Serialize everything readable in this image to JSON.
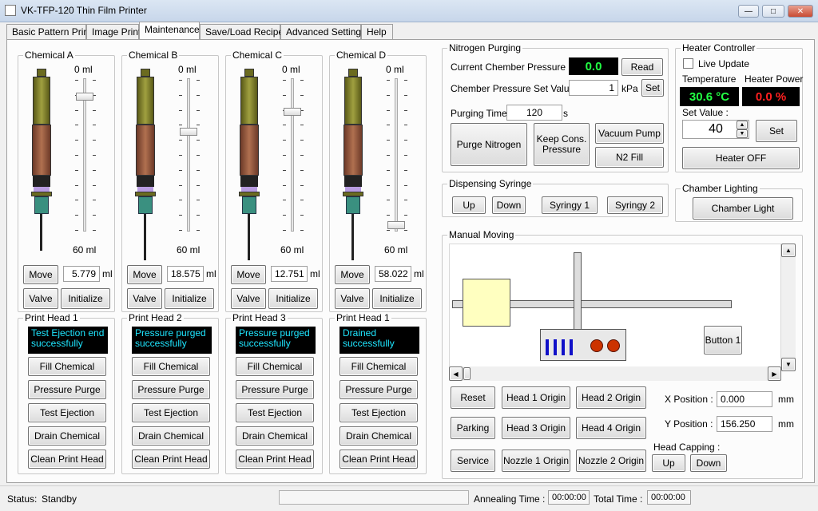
{
  "window": {
    "title": "VK-TFP-120 Thin Film Printer"
  },
  "tabs": [
    "Basic Pattern Print",
    "Image Print",
    "Maintenance",
    "Save/Load Recipe",
    "Advanced Settings",
    "Help"
  ],
  "chemicals": [
    {
      "title": "Chemical A",
      "top_label": "0 ml",
      "bottom_label": "60 ml",
      "volume": "5.779",
      "unit": "ml",
      "move": "Move",
      "valve": "Valve",
      "initialize": "Initialize",
      "level": 0.12,
      "head_title": "Print Head 1",
      "message": "Test Ejection end successfully"
    },
    {
      "title": "Chemical B",
      "top_label": "0 ml",
      "bottom_label": "60 ml",
      "volume": "18.575",
      "unit": "ml",
      "move": "Move",
      "valve": "Valve",
      "initialize": "Initialize",
      "level": 0.35,
      "head_title": "Print Head 2",
      "message": "Pressure purged successfully"
    },
    {
      "title": "Chemical C",
      "top_label": "0 ml",
      "bottom_label": "60 ml",
      "volume": "12.751",
      "unit": "ml",
      "move": "Move",
      "valve": "Valve",
      "initialize": "Initialize",
      "level": 0.22,
      "head_title": "Print Head 3",
      "message": "Pressure purged successfully"
    },
    {
      "title": "Chemical D",
      "top_label": "0 ml",
      "bottom_label": "60 ml",
      "volume": "58.022",
      "unit": "ml",
      "move": "Move",
      "valve": "Valve",
      "initialize": "Initialize",
      "level": 0.96,
      "head_title": "Print Head 1",
      "message": "Drained successfully"
    }
  ],
  "head_buttons": [
    "Fill Chemical",
    "Pressure Purge",
    "Test Ejection",
    "Drain Chemical",
    "Clean Print Head"
  ],
  "nitrogen": {
    "title": "Nitrogen Purging",
    "pressure_label": "Current Chember Pressure :",
    "pressure_value": "0.0",
    "read": "Read",
    "setvalue_label": "Chember Pressure Set Value :",
    "setvalue": "1",
    "unit": "kPa",
    "set": "Set",
    "time_label": "Purging Time:",
    "time_value": "120",
    "time_unit": "s",
    "purge": "Purge Nitrogen",
    "keep": "Keep Cons. Pressure",
    "vacuum": "Vacuum Pump",
    "n2fill": "N2 Fill"
  },
  "heater": {
    "title": "Heater Controller",
    "live_update": "Live Update",
    "temp_label": "Temperature",
    "power_label": "Heater Power",
    "temp_value": "30.6 °C",
    "power_value": "0.0 %",
    "setvalue_label": "Set Value :",
    "setvalue": "40",
    "set": "Set",
    "off": "Heater OFF"
  },
  "syringe": {
    "title": "Dispensing Syringe",
    "up": "Up",
    "down": "Down",
    "s1": "Syringy 1",
    "s2": "Syringy 2"
  },
  "lighting": {
    "title": "Chamber Lighting",
    "button": "Chamber Light"
  },
  "manual": {
    "title": "Manual Moving",
    "button1": "Button 1",
    "reset": "Reset",
    "head1": "Head 1 Origin",
    "head2": "Head 2 Origin",
    "parking": "Parking",
    "head3": "Head 3 Origin",
    "head4": "Head 4 Origin",
    "service": "Service",
    "nozzle1": "Nozzle 1 Origin",
    "nozzle2": "Nozzle 2 Origin",
    "xlabel": "X Position :",
    "xvalue": "0.000",
    "ylabel": "Y Position :",
    "yvalue": "156.250",
    "unit": "mm",
    "capping_label": "Head Capping :",
    "cap_up": "Up",
    "cap_down": "Down"
  },
  "status": {
    "label": "Status:",
    "value": "Standby",
    "annealing_label": "Annealing Time :",
    "annealing_value": "00:00:00",
    "total_label": "Total Time :",
    "total_value": "00:00:00"
  },
  "colors": {
    "lcd_green": "#22ff44",
    "lcd_red": "#ff2020",
    "msg_cyan": "#1ee6ff",
    "sample_yellow": "#ffffc0",
    "nozzle_blue": "#1010c8",
    "nozzle_orange": "#cc3300"
  }
}
